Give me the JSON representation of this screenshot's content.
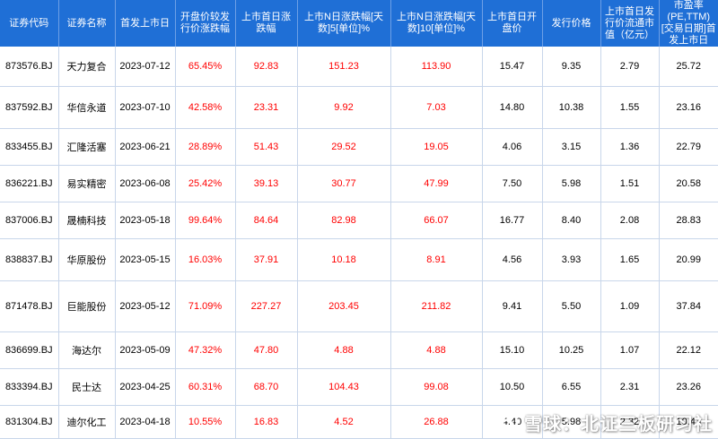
{
  "table": {
    "headers": [
      "证券代码",
      "证券名称",
      "首发上市日",
      "开盘价较发行价涨跌幅",
      "上市首日涨跌幅",
      "上市N日涨跌幅[天数]5[单位]%",
      "上市N日涨跌幅[天数]10[单位]%",
      "上市首日开盘价",
      "发行价格",
      "上市首日发行价流通市值（亿元）",
      "市盈率(PE,TTM)[交易日期]首发上市日"
    ],
    "rows": [
      [
        "873576.BJ",
        "天力复合",
        "2023-07-12",
        "65.45%",
        "92.83",
        "151.23",
        "113.90",
        "15.47",
        "9.35",
        "2.79",
        "25.72"
      ],
      [
        "837592.BJ",
        "华信永道",
        "2023-07-10",
        "42.58%",
        "23.31",
        "9.92",
        "7.03",
        "14.80",
        "10.38",
        "1.55",
        "23.16"
      ],
      [
        "833455.BJ",
        "汇隆活塞",
        "2023-06-21",
        "28.89%",
        "51.43",
        "29.52",
        "19.05",
        "4.06",
        "3.15",
        "1.36",
        "22.79"
      ],
      [
        "836221.BJ",
        "易实精密",
        "2023-06-08",
        "25.42%",
        "39.13",
        "30.77",
        "47.99",
        "7.50",
        "5.98",
        "1.51",
        "20.58"
      ],
      [
        "837006.BJ",
        "晟楠科技",
        "2023-05-18",
        "99.64%",
        "84.64",
        "82.98",
        "66.07",
        "16.77",
        "8.40",
        "2.08",
        "28.83"
      ],
      [
        "838837.BJ",
        "华原股份",
        "2023-05-15",
        "16.03%",
        "37.91",
        "10.18",
        "8.91",
        "4.56",
        "3.93",
        "1.65",
        "20.99"
      ],
      [
        "871478.BJ",
        "巨能股份",
        "2023-05-12",
        "71.09%",
        "227.27",
        "203.45",
        "211.82",
        "9.41",
        "5.50",
        "1.09",
        "37.84"
      ],
      [
        "836699.BJ",
        "海达尔",
        "2023-05-09",
        "47.32%",
        "47.80",
        "4.88",
        "4.88",
        "15.10",
        "10.25",
        "1.07",
        "22.12"
      ],
      [
        "833394.BJ",
        "民士达",
        "2023-04-25",
        "60.31%",
        "68.70",
        "104.43",
        "99.08",
        "10.50",
        "6.55",
        "2.31",
        "23.26"
      ],
      [
        "831304.BJ",
        "迪尔化工",
        "2023-04-18",
        "10.55%",
        "16.83",
        "4.52",
        "26.88",
        "4.40",
        "5.98",
        "2.32",
        "10.43"
      ]
    ]
  },
  "watermark": {
    "text": "雪球：北证三板研习社"
  },
  "colors": {
    "header_bg": "#1f6fd6",
    "header_text": "#ffffff",
    "positive": "#ff0000",
    "border": "#c8d6ea"
  }
}
